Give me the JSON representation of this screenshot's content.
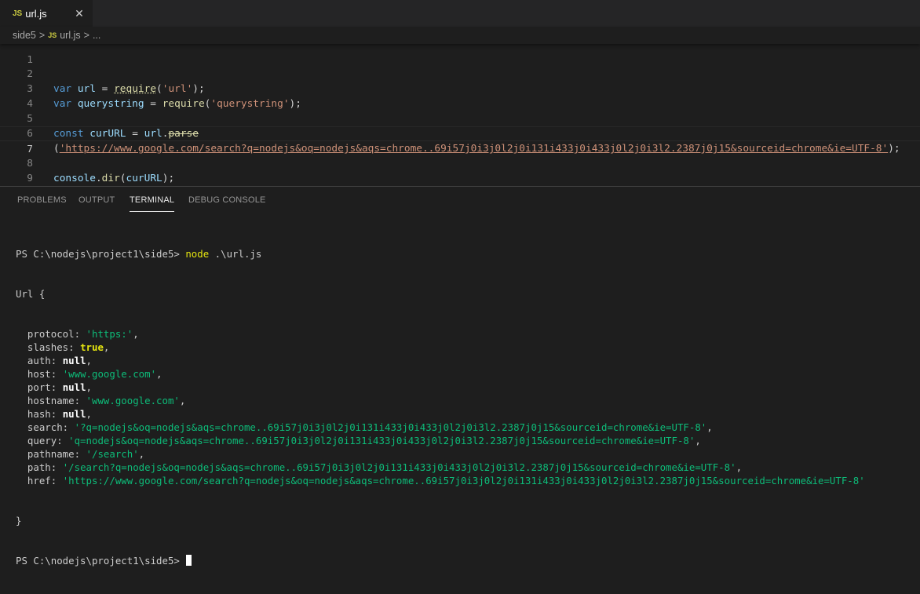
{
  "tab": {
    "badge": "JS",
    "title": "url.js",
    "close": "✕"
  },
  "breadcrumb": {
    "folder": "side5",
    "sep": ">",
    "badge": "JS",
    "file": "url.js",
    "more": "..."
  },
  "editor": {
    "line_numbers": [
      "1",
      "2",
      "3",
      "4",
      "5",
      "6",
      "7",
      "8",
      "9"
    ],
    "l2": {
      "kw": "var",
      "v": "url",
      "eq": " = ",
      "fn": "require",
      "o": "(",
      "s": "'url'",
      "c": ");"
    },
    "l3": {
      "kw": "var",
      "v": "querystring",
      "eq": " = ",
      "fn": "require",
      "o": "(",
      "s": "'querystring'",
      "c": ");"
    },
    "l5": {
      "kw": "const",
      "v": "curURL",
      "eq": " = ",
      "obj": "url",
      "dot": ".",
      "method": "parse"
    },
    "l6": {
      "o": "(",
      "s": "'https://www.google.com/search?q=nodejs&oq=nodejs&aqs=chrome..69i57j0i3j0l2j0i131i433j0i433j0l2j0i3l2.2387j0j15&sourceid=chrome&ie=UTF-8'",
      "c": ");"
    },
    "l8": {
      "obj": "console",
      "dot": ".",
      "fn": "dir",
      "o": "(",
      "v": "curURL",
      "c": ");"
    }
  },
  "panel_tabs": [
    "PROBLEMS",
    "OUTPUT",
    "TERMINAL",
    "DEBUG CONSOLE"
  ],
  "terminal": {
    "prompt": "PS C:\\nodejs\\project1\\side5>",
    "command": "node",
    "args": " .\\url.js",
    "open": "Url {",
    "close": "}",
    "fields": [
      {
        "key": "  protocol: ",
        "val": "'https:'",
        "type": "str"
      },
      {
        "key": "  slashes: ",
        "val": "true",
        "type": "kw"
      },
      {
        "key": "  auth: ",
        "val": "null",
        "type": "null"
      },
      {
        "key": "  host: ",
        "val": "'www.google.com'",
        "type": "str"
      },
      {
        "key": "  port: ",
        "val": "null",
        "type": "null"
      },
      {
        "key": "  hostname: ",
        "val": "'www.google.com'",
        "type": "str"
      },
      {
        "key": "  hash: ",
        "val": "null",
        "type": "null"
      },
      {
        "key": "  search: ",
        "val": "'?q=nodejs&oq=nodejs&aqs=chrome..69i57j0i3j0l2j0i131i433j0i433j0l2j0i3l2.2387j0j15&sourceid=chrome&ie=UTF-8'",
        "type": "str"
      },
      {
        "key": "  query: ",
        "val": "'q=nodejs&oq=nodejs&aqs=chrome..69i57j0i3j0l2j0i131i433j0i433j0l2j0i3l2.2387j0j15&sourceid=chrome&ie=UTF-8'",
        "type": "str"
      },
      {
        "key": "  pathname: ",
        "val": "'/search'",
        "type": "str"
      },
      {
        "key": "  path: ",
        "val": "'/search?q=nodejs&oq=nodejs&aqs=chrome..69i57j0i3j0l2j0i131i433j0i433j0l2j0i3l2.2387j0j15&sourceid=chrome&ie=UTF-8'",
        "type": "str"
      },
      {
        "key": "  href: ",
        "val": "'https://www.google.com/search?q=nodejs&oq=nodejs&aqs=chrome..69i57j0i3j0l2j0i131i433j0i433j0l2j0i3l2.2387j0j15&sourceid=chrome&ie=UTF-8'",
        "type": "str"
      }
    ]
  }
}
